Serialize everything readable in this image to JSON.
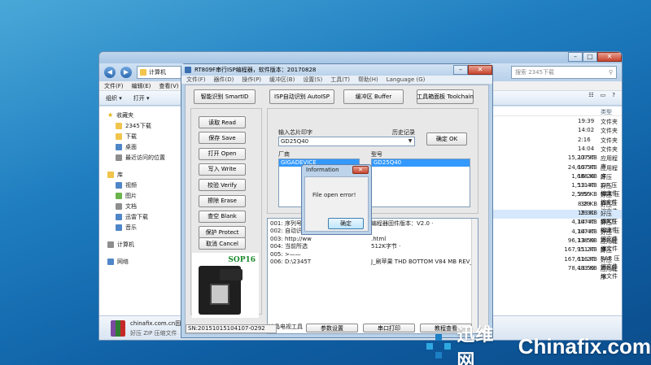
{
  "explorer": {
    "address": "计算机",
    "search_placeholder": "搜索 2345下载",
    "menu": [
      "文件(F)",
      "编辑(E)",
      "查看(V)"
    ],
    "toolbar": [
      "组织 ▾",
      "打开 ▾"
    ],
    "columns": {
      "type": "类型",
      "size": "大小"
    },
    "sidebar": [
      {
        "label": "收藏夹",
        "icon": "star-icon",
        "head": true
      },
      {
        "label": "2345下载",
        "icon": "folder-icon"
      },
      {
        "label": "下载",
        "icon": "folder-icon"
      },
      {
        "label": "桌面",
        "icon": "desktop-icon"
      },
      {
        "label": "最近访问的位置",
        "icon": "recent-icon"
      },
      {
        "label": "库",
        "icon": "library-icon",
        "head": true
      },
      {
        "label": "视频",
        "icon": "video-icon"
      },
      {
        "label": "图片",
        "icon": "picture-icon"
      },
      {
        "label": "文档",
        "icon": "document-icon"
      },
      {
        "label": "迅雷下载",
        "icon": "download-icon"
      },
      {
        "label": "音乐",
        "icon": "music-icon"
      },
      {
        "label": "计算机",
        "icon": "computer-icon",
        "head": true
      },
      {
        "label": "网络",
        "icon": "network-icon",
        "head": true
      }
    ],
    "files": [
      {
        "date": "19:39",
        "type": "文件夹",
        "size": ""
      },
      {
        "date": "14:02",
        "type": "文件夹",
        "size": ""
      },
      {
        "date": "2:16",
        "type": "文件夹",
        "size": ""
      },
      {
        "date": "14:04",
        "type": "文件夹",
        "size": ""
      },
      {
        "date": "13:57",
        "type": "应用程序",
        "size": "15,207 KB"
      },
      {
        "date": "13:57",
        "type": "应用程序",
        "size": "24,667 KB"
      },
      {
        "date": "16:28",
        "type": "好压 ZIP 压缩文件",
        "size": "1,688 KB"
      },
      {
        "date": "13:47",
        "type": "好压 RAR 压缩文件",
        "size": "1,511 KB"
      },
      {
        "date": "3:55",
        "type": "好压 ZIP 压缩文件",
        "size": "2,599 KB"
      },
      {
        "date": "8:29",
        "type": "好压 RAR 压缩文件",
        "size": "38 KB"
      },
      {
        "date": "19:31",
        "type": "好压 ZIP 压缩文件",
        "size": "23 KB",
        "highlight": true
      },
      {
        "date": "14:47",
        "type": "好压 RAR 压缩文件",
        "size": "4,107 KB"
      },
      {
        "date": "14:47",
        "type": "好压 ZIP 压缩文件",
        "size": "4,107 KB"
      },
      {
        "date": "13:59",
        "type": "应用程序",
        "size": "96,138 KB"
      },
      {
        "date": "11:27",
        "type": "好压 RAR 压缩文件",
        "size": "167,951 KB"
      },
      {
        "date": "11:27",
        "type": "好压 ZIP 压缩文件",
        "size": "167,616 KB"
      },
      {
        "date": "13:59",
        "type": "应用程序",
        "size": "78,483 KB"
      }
    ],
    "bottom": {
      "name": "chinafix.com.cn固",
      "sub": "好压 ZIP 压缩文件"
    }
  },
  "rt": {
    "title": "RT809F串行ISP编程器，软件版本：20170828",
    "menu": [
      "文件(F)",
      "器件(D)",
      "操作(P)",
      "缓冲区(B)",
      "设置(S)",
      "工具(T)",
      "帮助(H)",
      "Language (G)"
    ],
    "top_buttons": [
      "智能识别 SmartID",
      "ISP自动识别 AutoISP",
      "缓冲区 Buffer",
      "工具箱面板 Toolchain"
    ],
    "side_buttons": [
      "读取 Read",
      "保存 Save",
      "打开 Open",
      "写入 Write",
      "校验 Verify",
      "擦除 Erase",
      "查空 Blank",
      "保护 Protect"
    ],
    "cancel": "取消 Cancel",
    "chip_label": "输入芯片印字",
    "history_label": "历史记录",
    "chip_value": "GD25Q40",
    "ok": "确定 OK",
    "vendor_label": "厂商",
    "model_label": "型号",
    "vendor_selected": "GIGADEVICE",
    "model_selected": "GD25Q40",
    "log": [
      {
        "left": "001: 序列号：",
        "right": "编程器固件版本：V2.0 ·"
      },
      {
        "left": "002: 自动识别",
        "right": ""
      },
      {
        "left": "003: http://ww",
        "right": ".html"
      },
      {
        "left": "004: 当前所选",
        "right": "512K字节 ·"
      },
      {
        "left": "005: >——",
        "right": ""
      },
      {
        "left": "006: D:\\2345T",
        "right": "J_刷苹果 THD BOTTOM V84 MB REV_D U1"
      }
    ],
    "socket_label": "SOP16",
    "serial": "SN:20151015104107-0292",
    "bottom_label": "液晶电视工具",
    "bottom_buttons": [
      "参数设置",
      "串口打印",
      "教程查看"
    ]
  },
  "info": {
    "title": "Information",
    "message": "File open error!",
    "ok": "确定",
    "close": "✕"
  },
  "watermark": {
    "cn": "迅维网",
    "en": "Chinafix.com"
  }
}
